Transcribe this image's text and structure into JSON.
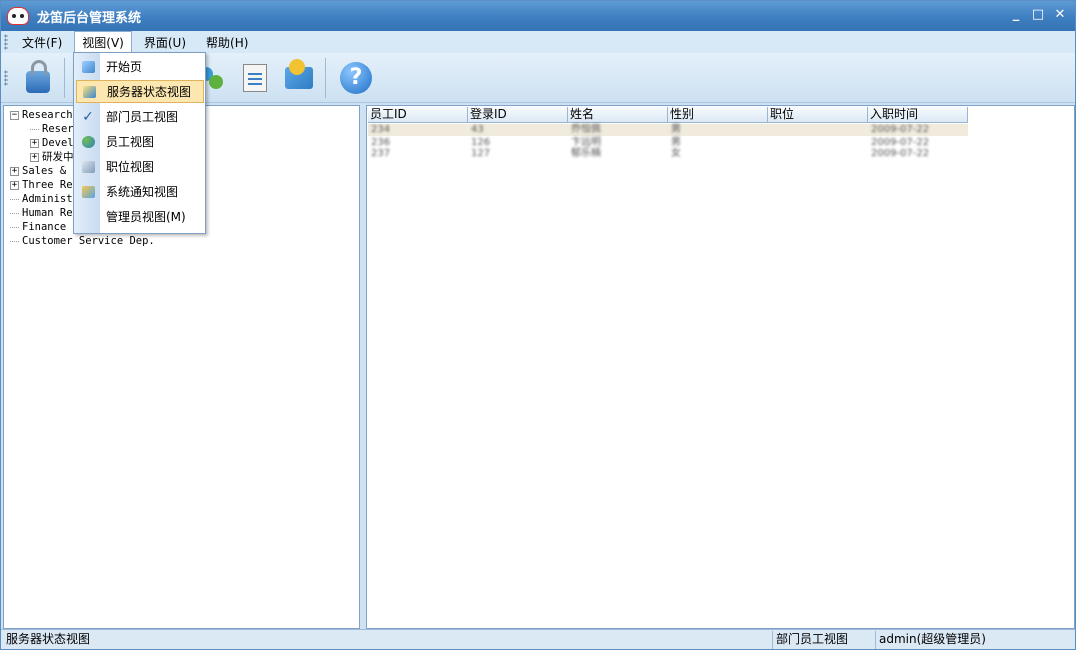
{
  "window": {
    "title": "龙笛后台管理系统",
    "controls": [
      "_",
      "□",
      "✕"
    ]
  },
  "menu": {
    "items": [
      {
        "label": "文件(F)"
      },
      {
        "label": "视图(V)"
      },
      {
        "label": "界面(U)"
      },
      {
        "label": "帮助(H)"
      }
    ]
  },
  "toolbar": {
    "buttons": [
      "lock-icon",
      "people-icon",
      "documents-icon",
      "mail-icon",
      "help-icon"
    ]
  },
  "dropdown": {
    "items": [
      {
        "label": "开始页",
        "icon": "cube-icon"
      },
      {
        "label": "服务器状态视图",
        "icon": "server-icon",
        "highlighted": true
      },
      {
        "label": "部门员工视图",
        "icon": "checkmark-icon",
        "checked": true
      },
      {
        "label": "员工视图",
        "icon": "people-icon"
      },
      {
        "label": "职位视图",
        "icon": "position-icon"
      },
      {
        "label": "系统通知视图",
        "icon": "mail-icon"
      },
      {
        "label": "管理员视图(M)",
        "icon": ""
      }
    ]
  },
  "tree": {
    "nodes": [
      {
        "label": "Research",
        "expander": "−"
      },
      {
        "label": "Reser"
      },
      {
        "label": "Devel",
        "expander": "+"
      },
      {
        "label": "研发中",
        "expander": "+"
      },
      {
        "label": "Sales &",
        "expander": "+"
      },
      {
        "label": "Three Re",
        "expander": "+"
      },
      {
        "label": "Administ"
      },
      {
        "label": "Human Re"
      },
      {
        "label": "Finance"
      },
      {
        "label": "Customer Service Dep."
      }
    ]
  },
  "grid": {
    "headers": [
      "员工ID",
      "登录ID",
      "姓名",
      "性别",
      "职位",
      "入职时间"
    ],
    "rows": [
      [
        "234",
        "43",
        "乔恒佩",
        "男",
        "",
        "2009-07-22"
      ],
      [
        "236",
        "126",
        "卞远明",
        "男",
        "",
        "2009-07-22"
      ],
      [
        "237",
        "127",
        "郁乐楠",
        "女",
        "",
        "2009-07-22"
      ]
    ]
  },
  "status": {
    "left": "服务器状态视图",
    "view": "部门员工视图",
    "user": "admin(超级管理员)"
  }
}
